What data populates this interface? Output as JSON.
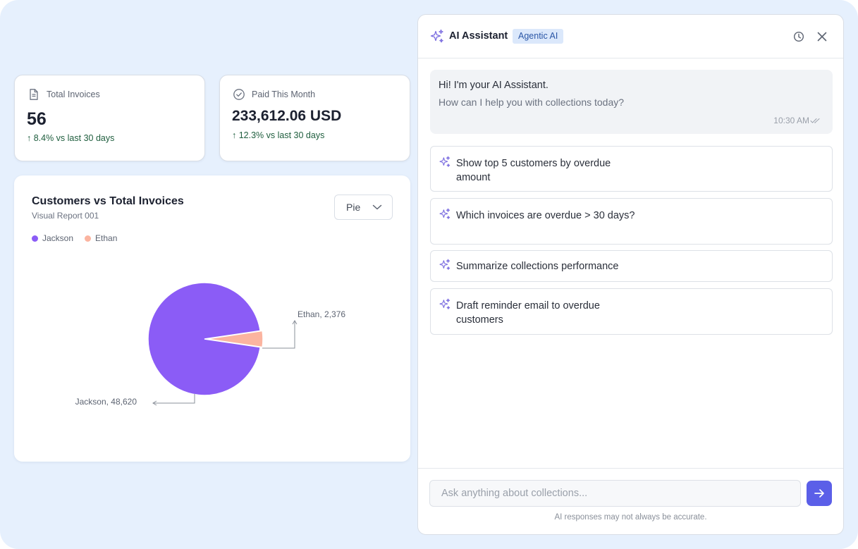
{
  "kpis": {
    "total_invoices": {
      "label": "Total Invoices",
      "value": "56",
      "delta": "↑ 8.4% vs last 30 days",
      "icon": "document-icon"
    },
    "paid_this_month": {
      "label": "Paid This Month",
      "value": "233,612.06 USD",
      "delta": "↑ 12.3% vs last 30 days",
      "icon": "check-circle-icon"
    }
  },
  "chart_card": {
    "title": "Customers vs Total Invoices",
    "subtitle": "Visual Report 001",
    "chart_type_select": "Pie"
  },
  "chart_data": {
    "type": "pie",
    "title": "Customers vs Total Invoices",
    "subtitle": "Visual Report 001",
    "categories": [
      "Jackson",
      "Ethan"
    ],
    "values": [
      48620,
      2376
    ],
    "colors": [
      "#8b5cf6",
      "#fbb4a0"
    ],
    "data_labels": [
      "Jackson, 48,620",
      "Ethan, 2,376"
    ],
    "legend_position": "top-left"
  },
  "assistant": {
    "title": "AI Assistant",
    "badge": "Agentic AI",
    "greeting": "Hi! I'm your AI Assistant.",
    "question": "How can I help you with collections today?",
    "timestamp": "10:30 AM",
    "suggestions": [
      "Show top 5 customers by overdue amount",
      "Which invoices are overdue > 30 days?",
      "Summarize collections performance",
      "Draft reminder email to overdue customers"
    ],
    "input_placeholder": "Ask anything about collections...",
    "disclaimer": "AI responses may not always be accurate."
  },
  "colors": {
    "accent": "#5b5fe8",
    "sparkle": "#7c6ee0",
    "badge_bg": "#dbe8fb",
    "badge_text": "#2a56a6",
    "delta_positive": "#1f5e3e",
    "background": "#e6f0fd"
  }
}
